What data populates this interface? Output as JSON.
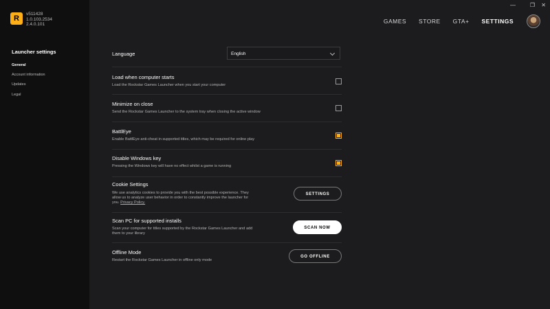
{
  "app": {
    "logo_letter": "R",
    "versions": [
      "v511428",
      "1.0.103.2534",
      "2.4.0.101"
    ]
  },
  "sidebar": {
    "title": "Launcher settings",
    "items": [
      {
        "label": "General"
      },
      {
        "label": "Account information"
      },
      {
        "label": "Updates"
      },
      {
        "label": "Legal"
      }
    ]
  },
  "nav": {
    "items": [
      {
        "label": "GAMES"
      },
      {
        "label": "STORE"
      },
      {
        "label": "GTA+"
      },
      {
        "label": "SETTINGS"
      }
    ],
    "active": "SETTINGS"
  },
  "window": {
    "restore": "❐",
    "close": "✕",
    "minimize": "—"
  },
  "settings": {
    "language": {
      "title": "Language",
      "value": "English"
    },
    "load_start": {
      "title": "Load when computer starts",
      "desc": "Load the Rockstar Games Launcher when you start your computer",
      "checked": false
    },
    "minimize_close": {
      "title": "Minimize on close",
      "desc": "Send the Rockstar Games Launcher to the system tray when closing the active window",
      "checked": false
    },
    "battleye": {
      "title": "BattlEye",
      "desc": "Enable BattlEye anti-cheat in supported titles, which may be required for online play",
      "checked": true
    },
    "disable_winkey": {
      "title": "Disable Windows key",
      "desc": "Pressing the Windows key will have no effect whilst a game is running",
      "checked": true
    },
    "cookie": {
      "title": "Cookie Settings",
      "desc_line1": "We use analytics cookies to provide you with the best possible experience. They",
      "desc_line2": "allow us to analyze user behavior in order to constantly improve the launcher for",
      "desc_line3_prefix": "you.",
      "desc_link": "Privacy Policy.",
      "button": "SETTINGS"
    },
    "scan": {
      "title": "Scan PC for supported installs",
      "desc_line1": "Scan your computer for titles supported by the Rockstar Games Launcher and add",
      "desc_line2": "them to your library",
      "button": "SCAN NOW"
    },
    "offline": {
      "title": "Offline Mode",
      "desc": "Restart the Rockstar Games Launcher in offline only mode",
      "button": "GO OFFLINE"
    }
  },
  "colors": {
    "accent": "#fcaf17",
    "background": "#1c1c1e",
    "sidebar": "#0f0f10"
  }
}
